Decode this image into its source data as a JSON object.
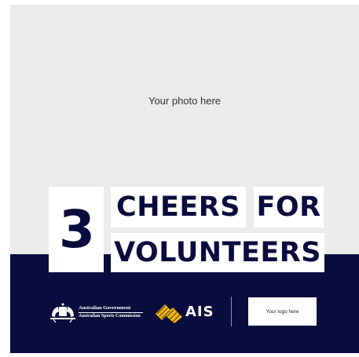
{
  "photo": {
    "placeholder": "Your photo here"
  },
  "headline": {
    "number": "3",
    "word1": "CHEERS",
    "word2": "FOR",
    "word3": "VOLUNTEERS"
  },
  "footer": {
    "gov_line1": "Australian Government",
    "gov_line2": "Australian Sports Commission",
    "ais_label": "AIS",
    "logo_placeholder": "Your logo here"
  },
  "colors": {
    "navy": "#0a0c3d",
    "photo_bg": "#ebebeb",
    "ais_gold": "#f2b705"
  },
  "icons": {
    "gov_crest": "coat-of-arms-icon",
    "ais_mark": "ais-stripes-icon"
  }
}
